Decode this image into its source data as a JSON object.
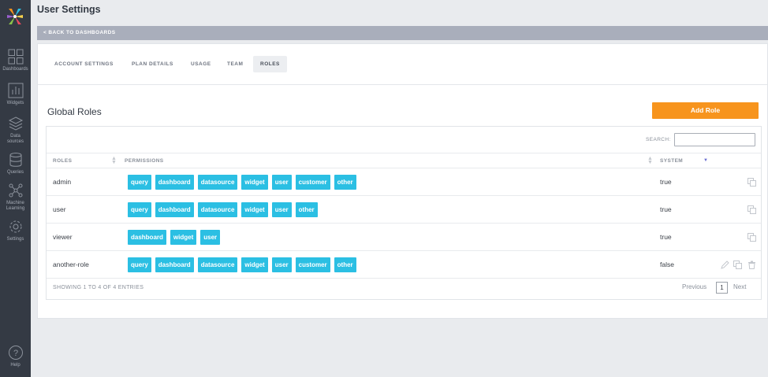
{
  "sidebar": {
    "items": [
      {
        "label": "Dashboards",
        "icon": "dashboards-icon"
      },
      {
        "label": "Widgets",
        "icon": "widgets-icon"
      },
      {
        "label": "Data sources",
        "icon": "data-sources-icon"
      },
      {
        "label": "Queries",
        "icon": "queries-icon"
      },
      {
        "label": "Machine Learning",
        "icon": "machine-learning-icon"
      },
      {
        "label": "Settings",
        "icon": "settings-icon"
      },
      {
        "label": "Help",
        "icon": "help-icon"
      }
    ]
  },
  "header": {
    "title": "User Settings",
    "back_label": "< BACK TO DASHBOARDS"
  },
  "tabs": [
    {
      "label": "ACCOUNT SETTINGS",
      "active": false
    },
    {
      "label": "PLAN DETAILS",
      "active": false
    },
    {
      "label": "USAGE",
      "active": false
    },
    {
      "label": "TEAM",
      "active": false
    },
    {
      "label": "ROLES",
      "active": true
    }
  ],
  "roles_section": {
    "title": "Global Roles",
    "add_button": "Add Role",
    "search_label": "SEARCH:",
    "search_value": "",
    "columns": [
      "ROLES",
      "PERMISSIONS",
      "SYSTEM"
    ],
    "rows": [
      {
        "name": "admin",
        "permissions": [
          "query",
          "dashboard",
          "datasource",
          "widget",
          "user",
          "customer",
          "other"
        ],
        "system": "true"
      },
      {
        "name": "user",
        "permissions": [
          "query",
          "dashboard",
          "datasource",
          "widget",
          "user",
          "other"
        ],
        "system": "true"
      },
      {
        "name": "viewer",
        "permissions": [
          "dashboard",
          "widget",
          "user"
        ],
        "system": "true"
      },
      {
        "name": "another-role",
        "permissions": [
          "query",
          "dashboard",
          "datasource",
          "widget",
          "user",
          "customer",
          "other"
        ],
        "system": "false"
      }
    ],
    "info": "SHOWING 1 TO 4 OF 4 ENTRIES",
    "pagination": {
      "prev": "Previous",
      "current": "1",
      "next": "Next"
    }
  },
  "colors": {
    "sidebar": "#343a44",
    "accent_orange": "#f7941d",
    "permission_badge": "#2bbfe3"
  }
}
